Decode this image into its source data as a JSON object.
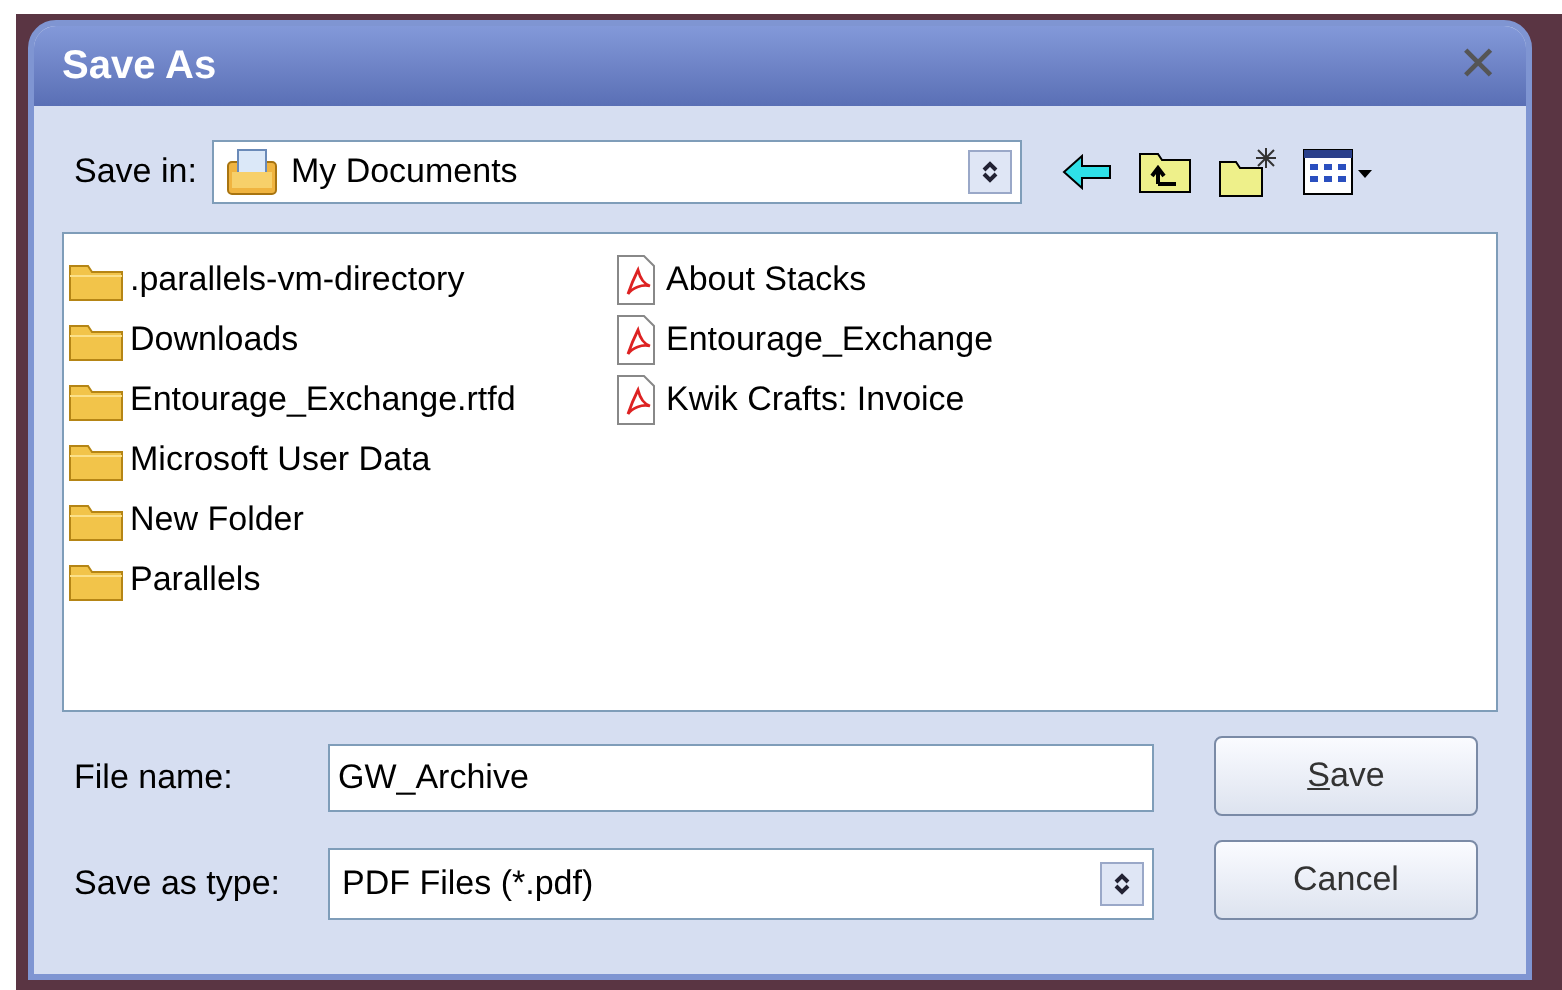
{
  "window": {
    "title": "Save As",
    "close": "✕"
  },
  "save_in": {
    "label": "Save in:",
    "value": "My Documents"
  },
  "files": [
    {
      "name": ".parallels-vm-directory",
      "kind": "folder"
    },
    {
      "name": "Downloads",
      "kind": "folder"
    },
    {
      "name": "Entourage_Exchange.rtfd",
      "kind": "folder"
    },
    {
      "name": "Microsoft User Data",
      "kind": "folder"
    },
    {
      "name": "New Folder",
      "kind": "folder"
    },
    {
      "name": "Parallels",
      "kind": "folder"
    },
    {
      "name": "About Stacks",
      "kind": "pdf"
    },
    {
      "name": "Entourage_Exchange",
      "kind": "pdf"
    },
    {
      "name": "Kwik Crafts: Invoice",
      "kind": "pdf"
    }
  ],
  "file_name": {
    "label": "File name:",
    "value": "GW_Archive"
  },
  "save_as_type": {
    "label": "Save as type:",
    "value": "PDF Files (*.pdf)"
  },
  "buttons": [
    {
      "label_parts": [
        "S",
        "ave"
      ]
    },
    {
      "label_parts": [
        "Cancel"
      ]
    }
  ]
}
